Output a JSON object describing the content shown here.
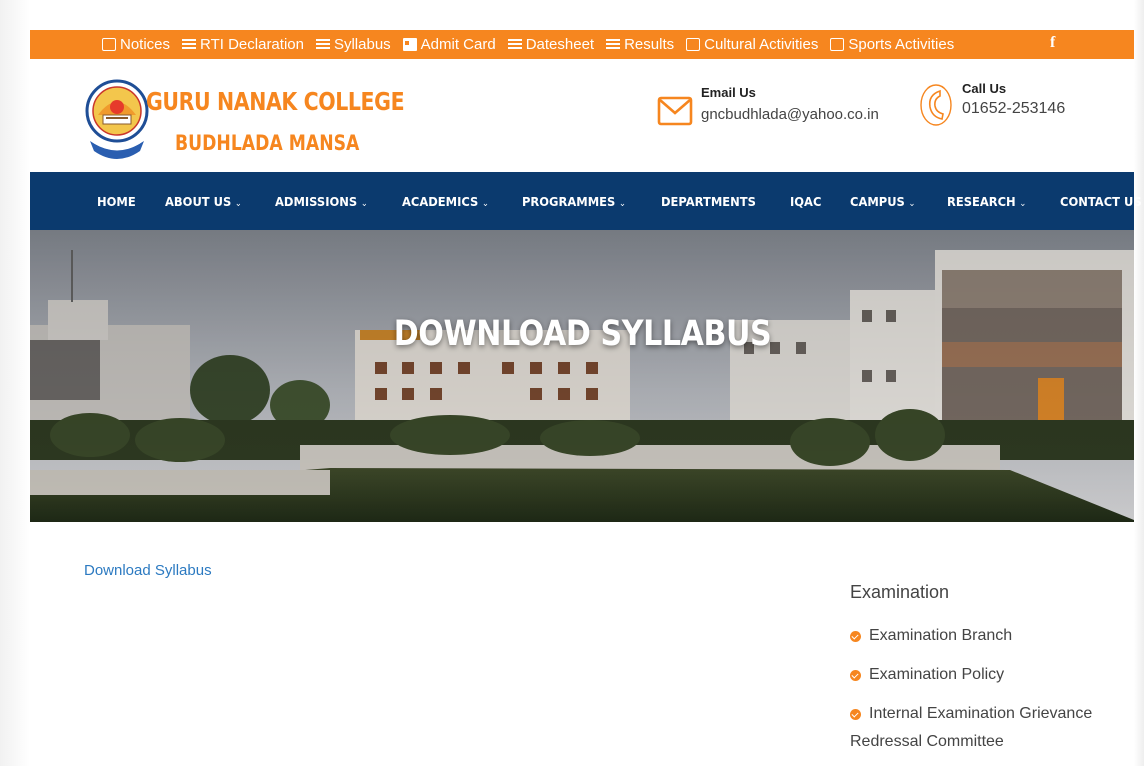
{
  "topbar": {
    "items": [
      {
        "label": "Notices",
        "icon": "page-icon"
      },
      {
        "label": "RTI Declaration",
        "icon": "list-icon"
      },
      {
        "label": "Syllabus",
        "icon": "list-icon"
      },
      {
        "label": "Admit Card",
        "icon": "id-card-icon"
      },
      {
        "label": "Datesheet",
        "icon": "list-icon"
      },
      {
        "label": "Results",
        "icon": "list-icon"
      },
      {
        "label": "Cultural Activities",
        "icon": "page-icon"
      },
      {
        "label": "Sports Activities",
        "icon": "page-icon"
      }
    ],
    "facebook": "f",
    "color": "#f6861f"
  },
  "header": {
    "brand_line1": "GURU NANAK COLLEGE",
    "brand_line2": "BUDHLADA MANSA",
    "email": {
      "label": "Email Us",
      "value": "gncbudhlada@yahoo.co.in"
    },
    "call": {
      "label": "Call Us",
      "value": "01652-253146"
    }
  },
  "nav": {
    "color": "#0b3a6e",
    "items": [
      {
        "label": "HOME",
        "dropdown": false
      },
      {
        "label": "ABOUT US",
        "dropdown": true
      },
      {
        "label": "ADMISSIONS",
        "dropdown": true
      },
      {
        "label": "ACADEMICS",
        "dropdown": true
      },
      {
        "label": "PROGRAMMES",
        "dropdown": true
      },
      {
        "label": "DEPARTMENTS",
        "dropdown": false
      },
      {
        "label": "IQAC",
        "dropdown": false
      },
      {
        "label": "CAMPUS",
        "dropdown": true
      },
      {
        "label": "RESEARCH",
        "dropdown": true
      },
      {
        "label": "CONTACT US",
        "dropdown": false
      }
    ]
  },
  "banner": {
    "title": "DOWNLOAD SYLLABUS"
  },
  "content": {
    "link": "Download Syllabus"
  },
  "sidebar": {
    "title": "Examination",
    "items": [
      "Examination Branch",
      "Examination Policy",
      "Internal Examination Grievance"
    ],
    "item_continuation": "Redressal Committee"
  }
}
